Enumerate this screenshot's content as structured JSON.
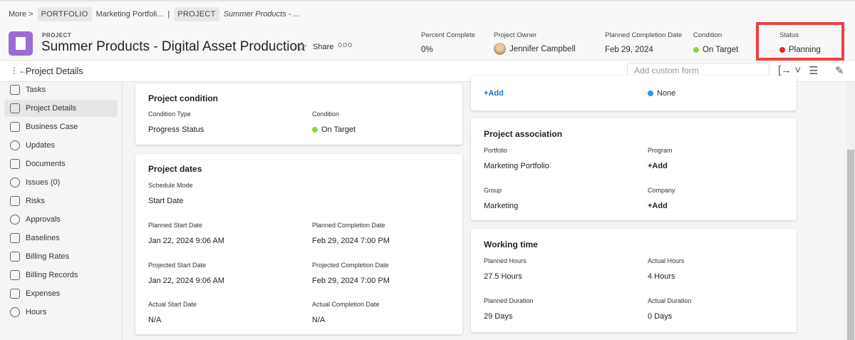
{
  "breadcrumb": {
    "more": "More >",
    "portfolio_chip": "PORTFOLIO",
    "portfolio": "Marketing Portfoli...",
    "sep": "|",
    "project_chip": "PROJECT",
    "project": "Summer Products - ..."
  },
  "header": {
    "type": "PROJECT",
    "title": "Summer Products - Digital Asset Production",
    "share": "Share",
    "more": "ooo",
    "meta": {
      "percent_label": "Percent Complete",
      "percent": "0%",
      "owner_label": "Project Owner",
      "owner": "Jennifer Campbell",
      "pcd_label": "Planned Completion Date",
      "pcd": "Feb 29, 2024",
      "condition_label": "Condition",
      "condition": "On Target",
      "status_label": "Status",
      "status": "Planning"
    }
  },
  "colors": {
    "on_target": "#8fd43a",
    "planning": "#e8262b",
    "none": "#3a8fe8",
    "accent": "#9b6bd6"
  },
  "toolbar": {
    "title": "Project Details",
    "custom_form_placeholder": "Add custom form"
  },
  "sidebar": {
    "items": [
      "Tasks",
      "Project Details",
      "Business Case",
      "Updates",
      "Documents",
      "Issues (0)",
      "Risks",
      "Approvals",
      "Baselines",
      "Billing Rates",
      "Billing Records",
      "Expenses",
      "Hours"
    ]
  },
  "condition_card": {
    "title": "Project condition",
    "type_label": "Condition Type",
    "type": "Progress Status",
    "cond_label": "Condition",
    "cond": "On Target"
  },
  "dates_card": {
    "title": "Project dates",
    "mode_label": "Schedule Mode",
    "mode": "Start Date",
    "pss_label": "Planned Start Date",
    "pss": "Jan 22, 2024 9:06 AM",
    "pcd_label": "Planned Completion Date",
    "pcd": "Feb 29, 2024 7:00 PM",
    "prs_label": "Projected Start Date",
    "prs": "Jan 22, 2024 9:06 AM",
    "prc_label": "Projected Completion Date",
    "prc": "Feb 29, 2024 7:00 PM",
    "as_label": "Actual Start Date",
    "as": "N/A",
    "ac_label": "Actual Completion Date",
    "ac": "N/A"
  },
  "top_right_card": {
    "add": "+Add",
    "none": "None"
  },
  "assoc_card": {
    "title": "Project association",
    "portfolio_label": "Portfolio",
    "portfolio": "Marketing Portfolio",
    "program_label": "Program",
    "program": "+Add",
    "group_label": "Group",
    "group": "Marketing",
    "company_label": "Company",
    "company": "+Add"
  },
  "working_card": {
    "title": "Working time",
    "ph_label": "Planned Hours",
    "ph": "27.5 Hours",
    "ah_label": "Actual Hours",
    "ah": "4 Hours",
    "pd_label": "Planned Duration",
    "pd": "29 Days",
    "ad_label": "Actual Duration",
    "ad": "0 Days"
  }
}
